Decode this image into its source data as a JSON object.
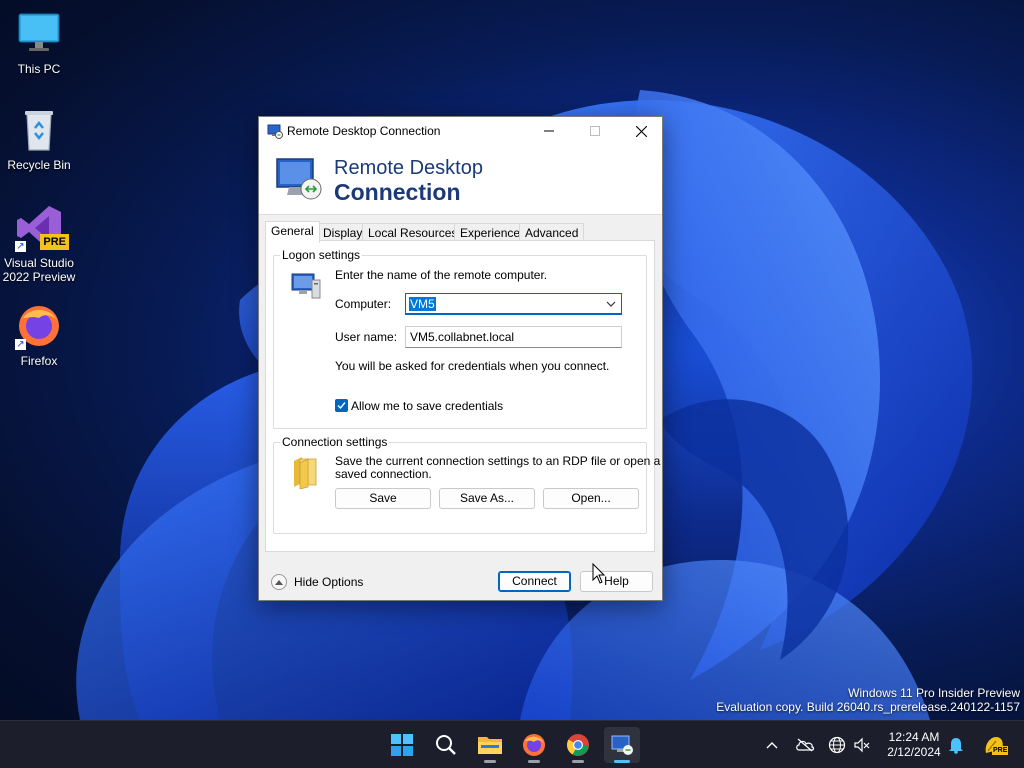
{
  "desktop": {
    "icons": [
      {
        "label": "This PC"
      },
      {
        "label": "Recycle Bin"
      },
      {
        "label": "Visual Studio\n2022 Preview",
        "line1": "Visual Studio",
        "line2": "2022 Preview",
        "badge": "PRE"
      },
      {
        "label": "Firefox"
      }
    ],
    "watermark": {
      "line1": "Windows 11 Pro Insider Preview",
      "line2": "Evaluation copy. Build 26040.rs_prerelease.240122-1157"
    }
  },
  "dialog": {
    "title": "Remote Desktop Connection",
    "banner": {
      "line1": "Remote Desktop",
      "line2": "Connection"
    },
    "tabs": [
      {
        "label": "General",
        "active": true
      },
      {
        "label": "Display"
      },
      {
        "label": "Local Resources"
      },
      {
        "label": "Experience"
      },
      {
        "label": "Advanced"
      }
    ],
    "logon": {
      "group_label": "Logon settings",
      "instruction": "Enter the name of the remote computer.",
      "computer_label": "Computer:",
      "computer_value": "VM5",
      "username_label": "User name:",
      "username_value": "VM5.collabnet.local",
      "credentials_note": "You will be asked for credentials when you connect.",
      "allow_save_label": "Allow me to save credentials",
      "allow_save_checked": true
    },
    "connection": {
      "group_label": "Connection settings",
      "description_line1": "Save the current connection settings to an RDP file or open a",
      "description_line2": "saved connection.",
      "save_label": "Save",
      "save_as_label": "Save As...",
      "open_label": "Open..."
    },
    "footer": {
      "hide_options_label": "Hide Options",
      "connect_label": "Connect",
      "help_label": "Help"
    }
  },
  "taskbar": {
    "apps": [
      "start-icon",
      "search-icon",
      "file-explorer-icon",
      "firefox-icon",
      "chrome-icon",
      "remote-desktop-icon"
    ],
    "clock": {
      "time": "12:24 AM",
      "date": "2/12/2024"
    },
    "tray_badge": "PRE"
  },
  "colors": {
    "accent": "#0067c0",
    "banner_text": "#1c3a78",
    "taskbar": "#1c1f2b"
  }
}
